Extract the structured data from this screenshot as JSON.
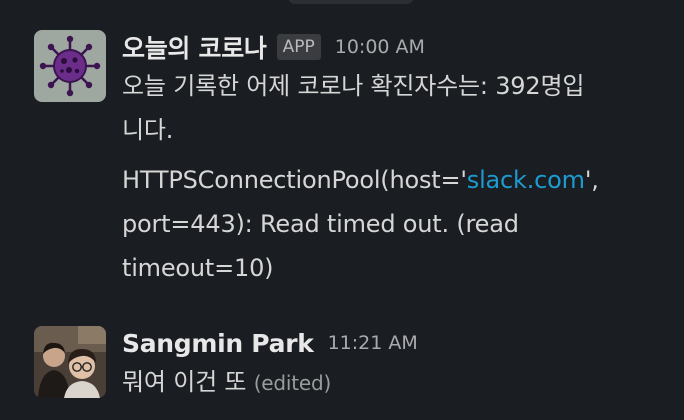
{
  "messages": {
    "bot": {
      "sender": "오늘의 코로나",
      "badge": "APP",
      "time": "10:00 AM",
      "line1": "오늘 기록한 어제 코로나 확진자수는: 392명입",
      "line2": "니다.",
      "error_prefix": "HTTPSConnectionPool(host='",
      "error_link": "slack.com",
      "error_suffix_1": "',",
      "error_line2": "port=443): Read timed out. (read",
      "error_line3": "timeout=10)"
    },
    "user": {
      "sender": "Sangmin Park",
      "time": "11:21 AM",
      "text": "뭐여 이건 또",
      "edited": "(edited)"
    }
  },
  "icons": {
    "bot_avatar": "virus-icon",
    "user_avatar": "photo-avatar"
  },
  "colors": {
    "background": "#1a1d21",
    "link": "#1d9bd1",
    "virus_body": "#6b2d8a"
  }
}
